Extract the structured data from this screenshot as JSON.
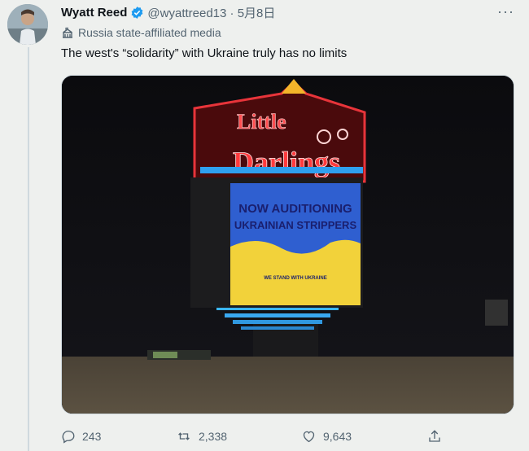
{
  "tweet": {
    "author_name": "Wyatt Reed",
    "handle_date": "@wyattreed13 · 5月8日",
    "label": "Russia state-affiliated media",
    "text": "The west's “solidarity” with Ukraine truly has no limits",
    "more": "···"
  },
  "media": {
    "sign_top": "Little",
    "sign_main": "Darlings",
    "board_line1": "NOW AUDITIONING",
    "board_line2": "UKRAINIAN STRIPPERS",
    "board_small": "WE STAND WITH UKRAINE",
    "colors": {
      "board_blue": "#2f5fd0",
      "board_yellow": "#f2d23a",
      "neon_red": "#c8141b"
    }
  },
  "actions": {
    "replies": "243",
    "retweets": "2,338",
    "likes": "9,643"
  },
  "icons": [
    "verified-badge-icon",
    "building-icon",
    "more-icon",
    "reply-icon",
    "retweet-icon",
    "like-icon",
    "share-icon"
  ]
}
